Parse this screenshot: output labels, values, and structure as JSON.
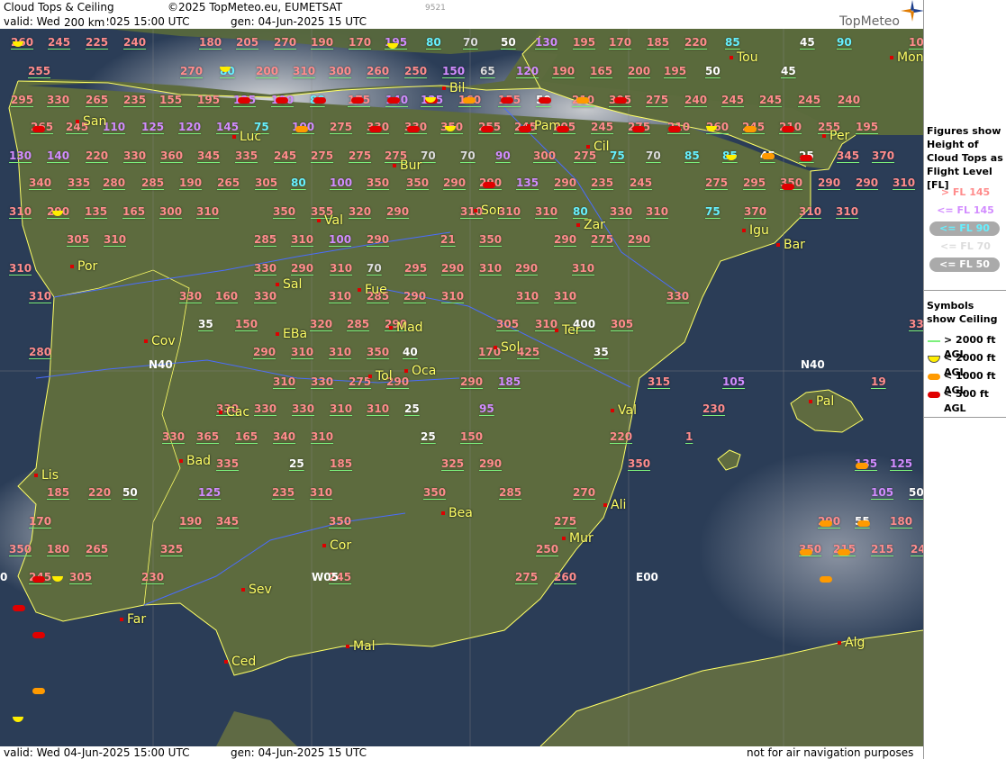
{
  "header": {
    "title": "Cloud Tops & Ceiling",
    "copyright": "©2025 TopMeteo.eu, EUMETSAT",
    "valid": "valid:  Wed  04-Jun-2025  15:00 UTC",
    "gen": "gen: 04-Jun-2025 15 UTC",
    "code": "9521",
    "brand": "TopMeteo"
  },
  "footer": {
    "valid": "valid:  Wed  04-Jun-2025  15:00 UTC",
    "gen": "gen: 04-Jun-2025 15 UTC",
    "disclaimer": "not for air navigation purposes"
  },
  "scale": {
    "label": "200 km"
  },
  "colors": {
    "above145": "#ff8c8c",
    "le145": "#d28cff",
    "le90": "#66f0ff",
    "le70": "#dcdcdc",
    "le50": "#ffffff",
    "sea": "#2b3d57",
    "land": "#5b6b3c",
    "coast": "#ffff66",
    "rivers": "#4a6cff"
  },
  "legend": {
    "figures_title": "Figures show Height of Cloud Tops as Flight Level  [FL]",
    "fl_items": [
      {
        "label": "> FL 145",
        "color": "#ff8c8c",
        "pill": false
      },
      {
        "label": "<= FL 145",
        "color": "#d28cff",
        "pill": false
      },
      {
        "label": "<= FL 90",
        "color": "#66f0ff",
        "pill": true
      },
      {
        "label": "<= FL 70",
        "color": "#dcdcdc",
        "pill": false
      },
      {
        "label": "<= FL 50",
        "color": "#ffffff",
        "pill": true
      }
    ],
    "symbols_title": "Symbols show Ceiling",
    "ceiling_items": [
      {
        "label": "> 2000 ft AGL",
        "symbol": "green-line"
      },
      {
        "label": "< 2000 ft AGL",
        "symbol": "yellow-half"
      },
      {
        "label": "< 1000 ft AGL",
        "symbol": "orange-pill"
      },
      {
        "label": "< 500 ft AGL",
        "symbol": "red-pill"
      }
    ]
  },
  "grid_labels": [
    "N40",
    "N40",
    "W05",
    "E00",
    "0"
  ],
  "cities": [
    "Tou",
    "Mon",
    "Bil",
    "San",
    "Pam",
    "Luc",
    "Cil",
    "Per",
    "Bur",
    "Val",
    "Sor",
    "Zar",
    "Igu",
    "Bar",
    "Por",
    "Sal",
    "Fue",
    "Mad",
    "Ter",
    "Cov",
    "EBa",
    "Oca",
    "Tol",
    "Sol",
    "Pal",
    "Cac",
    "Val",
    "Bad",
    "Lis",
    "Bea",
    "Ali",
    "Mur",
    "Cor",
    "Sev",
    "Far",
    "Mal",
    "Ced",
    "Alg"
  ],
  "flight_levels": [
    {
      "v": "260",
      "c": "above145"
    },
    {
      "v": "245",
      "c": "above145"
    },
    {
      "v": "225",
      "c": "above145"
    },
    {
      "v": "240",
      "c": "above145"
    },
    {
      "v": "180",
      "c": "above145"
    },
    {
      "v": "205",
      "c": "above145"
    },
    {
      "v": "270",
      "c": "above145"
    },
    {
      "v": "190",
      "c": "above145"
    },
    {
      "v": "170",
      "c": "above145"
    },
    {
      "v": "195",
      "c": "le145"
    },
    {
      "v": "80",
      "c": "le90"
    },
    {
      "v": "70",
      "c": "le70"
    },
    {
      "v": "50",
      "c": "le50"
    },
    {
      "v": "130",
      "c": "le145"
    },
    {
      "v": "195",
      "c": "above145"
    },
    {
      "v": "170",
      "c": "above145"
    },
    {
      "v": "185",
      "c": "above145"
    },
    {
      "v": "220",
      "c": "above145"
    },
    {
      "v": "85",
      "c": "le90"
    },
    {
      "v": "45",
      "c": "le50"
    },
    {
      "v": "90",
      "c": "le90"
    },
    {
      "v": "10",
      "c": "above145"
    },
    {
      "v": "255",
      "c": "above145"
    },
    {
      "v": "270",
      "c": "above145"
    },
    {
      "v": "80",
      "c": "le90"
    },
    {
      "v": "200",
      "c": "above145"
    },
    {
      "v": "310",
      "c": "above145"
    },
    {
      "v": "300",
      "c": "above145"
    },
    {
      "v": "260",
      "c": "above145"
    },
    {
      "v": "250",
      "c": "above145"
    },
    {
      "v": "150",
      "c": "le145"
    },
    {
      "v": "65",
      "c": "le70"
    },
    {
      "v": "120",
      "c": "le145"
    },
    {
      "v": "190",
      "c": "above145"
    },
    {
      "v": "165",
      "c": "above145"
    },
    {
      "v": "200",
      "c": "above145"
    },
    {
      "v": "195",
      "c": "above145"
    },
    {
      "v": "50",
      "c": "le50"
    },
    {
      "v": "45",
      "c": "le50"
    },
    {
      "v": "295",
      "c": "above145"
    },
    {
      "v": "330",
      "c": "above145"
    },
    {
      "v": "265",
      "c": "above145"
    },
    {
      "v": "235",
      "c": "above145"
    },
    {
      "v": "155",
      "c": "above145"
    },
    {
      "v": "195",
      "c": "above145"
    },
    {
      "v": "125",
      "c": "le145"
    },
    {
      "v": "100",
      "c": "le145"
    },
    {
      "v": "80",
      "c": "le90"
    },
    {
      "v": "175",
      "c": "above145"
    },
    {
      "v": "140",
      "c": "le145"
    },
    {
      "v": "125",
      "c": "le145"
    },
    {
      "v": "160",
      "c": "above145"
    },
    {
      "v": "155",
      "c": "above145"
    },
    {
      "v": "50",
      "c": "le50"
    },
    {
      "v": "210",
      "c": "above145"
    },
    {
      "v": "305",
      "c": "above145"
    },
    {
      "v": "275",
      "c": "above145"
    },
    {
      "v": "240",
      "c": "above145"
    },
    {
      "v": "245",
      "c": "above145"
    },
    {
      "v": "245",
      "c": "above145"
    },
    {
      "v": "245",
      "c": "above145"
    },
    {
      "v": "240",
      "c": "above145"
    },
    {
      "v": "265",
      "c": "above145"
    },
    {
      "v": "245",
      "c": "above145"
    },
    {
      "v": "110",
      "c": "le145"
    },
    {
      "v": "125",
      "c": "le145"
    },
    {
      "v": "120",
      "c": "le145"
    },
    {
      "v": "145",
      "c": "le145"
    },
    {
      "v": "75",
      "c": "le90"
    },
    {
      "v": "100",
      "c": "le145"
    },
    {
      "v": "275",
      "c": "above145"
    },
    {
      "v": "330",
      "c": "above145"
    },
    {
      "v": "330",
      "c": "above145"
    },
    {
      "v": "350",
      "c": "above145"
    },
    {
      "v": "255",
      "c": "above145"
    },
    {
      "v": "245",
      "c": "above145"
    },
    {
      "v": "205",
      "c": "above145"
    },
    {
      "v": "245",
      "c": "above145"
    },
    {
      "v": "275",
      "c": "above145"
    },
    {
      "v": "210",
      "c": "above145"
    },
    {
      "v": "260",
      "c": "above145"
    },
    {
      "v": "245",
      "c": "above145"
    },
    {
      "v": "210",
      "c": "above145"
    },
    {
      "v": "255",
      "c": "above145"
    },
    {
      "v": "195",
      "c": "above145"
    },
    {
      "v": "130",
      "c": "le145"
    },
    {
      "v": "140",
      "c": "le145"
    },
    {
      "v": "220",
      "c": "above145"
    },
    {
      "v": "330",
      "c": "above145"
    },
    {
      "v": "360",
      "c": "above145"
    },
    {
      "v": "345",
      "c": "above145"
    },
    {
      "v": "335",
      "c": "above145"
    },
    {
      "v": "245",
      "c": "above145"
    },
    {
      "v": "275",
      "c": "above145"
    },
    {
      "v": "275",
      "c": "above145"
    },
    {
      "v": "275",
      "c": "above145"
    },
    {
      "v": "70",
      "c": "le70"
    },
    {
      "v": "70",
      "c": "le70"
    },
    {
      "v": "90",
      "c": "le145"
    },
    {
      "v": "300",
      "c": "above145"
    },
    {
      "v": "275",
      "c": "above145"
    },
    {
      "v": "75",
      "c": "le90"
    },
    {
      "v": "70",
      "c": "le70"
    },
    {
      "v": "85",
      "c": "le90"
    },
    {
      "v": "85",
      "c": "le90"
    },
    {
      "v": "45",
      "c": "le50"
    },
    {
      "v": "25",
      "c": "le50"
    },
    {
      "v": "345",
      "c": "above145"
    },
    {
      "v": "370",
      "c": "above145"
    },
    {
      "v": "340",
      "c": "above145"
    },
    {
      "v": "335",
      "c": "above145"
    },
    {
      "v": "280",
      "c": "above145"
    },
    {
      "v": "285",
      "c": "above145"
    },
    {
      "v": "190",
      "c": "above145"
    },
    {
      "v": "265",
      "c": "above145"
    },
    {
      "v": "305",
      "c": "above145"
    },
    {
      "v": "80",
      "c": "le90"
    },
    {
      "v": "100",
      "c": "le145"
    },
    {
      "v": "350",
      "c": "above145"
    },
    {
      "v": "350",
      "c": "above145"
    },
    {
      "v": "290",
      "c": "above145"
    },
    {
      "v": "290",
      "c": "above145"
    },
    {
      "v": "135",
      "c": "le145"
    },
    {
      "v": "290",
      "c": "above145"
    },
    {
      "v": "235",
      "c": "above145"
    },
    {
      "v": "245",
      "c": "above145"
    },
    {
      "v": "275",
      "c": "above145"
    },
    {
      "v": "295",
      "c": "above145"
    },
    {
      "v": "350",
      "c": "above145"
    },
    {
      "v": "290",
      "c": "above145"
    },
    {
      "v": "290",
      "c": "above145"
    },
    {
      "v": "310",
      "c": "above145"
    },
    {
      "v": "310",
      "c": "above145"
    },
    {
      "v": "290",
      "c": "above145"
    },
    {
      "v": "135",
      "c": "above145"
    },
    {
      "v": "165",
      "c": "above145"
    },
    {
      "v": "300",
      "c": "above145"
    },
    {
      "v": "310",
      "c": "above145"
    },
    {
      "v": "350",
      "c": "above145"
    },
    {
      "v": "355",
      "c": "above145"
    },
    {
      "v": "320",
      "c": "above145"
    },
    {
      "v": "290",
      "c": "above145"
    },
    {
      "v": "310",
      "c": "above145"
    },
    {
      "v": "310",
      "c": "above145"
    },
    {
      "v": "310",
      "c": "above145"
    },
    {
      "v": "80",
      "c": "le90"
    },
    {
      "v": "330",
      "c": "above145"
    },
    {
      "v": "310",
      "c": "above145"
    },
    {
      "v": "75",
      "c": "le90"
    },
    {
      "v": "370",
      "c": "above145"
    },
    {
      "v": "310",
      "c": "above145"
    },
    {
      "v": "310",
      "c": "above145"
    },
    {
      "v": "305",
      "c": "above145"
    },
    {
      "v": "310",
      "c": "above145"
    },
    {
      "v": "285",
      "c": "above145"
    },
    {
      "v": "310",
      "c": "above145"
    },
    {
      "v": "100",
      "c": "le145"
    },
    {
      "v": "290",
      "c": "above145"
    },
    {
      "v": "21",
      "c": "above145"
    },
    {
      "v": "350",
      "c": "above145"
    },
    {
      "v": "290",
      "c": "above145"
    },
    {
      "v": "275",
      "c": "above145"
    },
    {
      "v": "290",
      "c": "above145"
    },
    {
      "v": "310",
      "c": "above145"
    },
    {
      "v": "330",
      "c": "above145"
    },
    {
      "v": "290",
      "c": "above145"
    },
    {
      "v": "310",
      "c": "above145"
    },
    {
      "v": "70",
      "c": "le70"
    },
    {
      "v": "295",
      "c": "above145"
    },
    {
      "v": "290",
      "c": "above145"
    },
    {
      "v": "310",
      "c": "above145"
    },
    {
      "v": "290",
      "c": "above145"
    },
    {
      "v": "310",
      "c": "above145"
    },
    {
      "v": "310",
      "c": "above145"
    },
    {
      "v": "330",
      "c": "above145"
    },
    {
      "v": "160",
      "c": "above145"
    },
    {
      "v": "330",
      "c": "above145"
    },
    {
      "v": "310",
      "c": "above145"
    },
    {
      "v": "285",
      "c": "above145"
    },
    {
      "v": "290",
      "c": "above145"
    },
    {
      "v": "310",
      "c": "above145"
    },
    {
      "v": "310",
      "c": "above145"
    },
    {
      "v": "310",
      "c": "above145"
    },
    {
      "v": "330",
      "c": "above145"
    },
    {
      "v": "35",
      "c": "le50"
    },
    {
      "v": "150",
      "c": "above145"
    },
    {
      "v": "320",
      "c": "above145"
    },
    {
      "v": "285",
      "c": "above145"
    },
    {
      "v": "290",
      "c": "above145"
    },
    {
      "v": "305",
      "c": "above145"
    },
    {
      "v": "310",
      "c": "above145"
    },
    {
      "v": "400",
      "c": "le50"
    },
    {
      "v": "305",
      "c": "above145"
    },
    {
      "v": "330",
      "c": "above145"
    },
    {
      "v": "280",
      "c": "above145"
    },
    {
      "v": "290",
      "c": "above145"
    },
    {
      "v": "310",
      "c": "above145"
    },
    {
      "v": "310",
      "c": "above145"
    },
    {
      "v": "350",
      "c": "above145"
    },
    {
      "v": "40",
      "c": "le50"
    },
    {
      "v": "170",
      "c": "above145"
    },
    {
      "v": "425",
      "c": "above145"
    },
    {
      "v": "35",
      "c": "le50"
    },
    {
      "v": "310",
      "c": "above145"
    },
    {
      "v": "330",
      "c": "above145"
    },
    {
      "v": "275",
      "c": "above145"
    },
    {
      "v": "290",
      "c": "above145"
    },
    {
      "v": "290",
      "c": "above145"
    },
    {
      "v": "185",
      "c": "le145"
    },
    {
      "v": "315",
      "c": "above145"
    },
    {
      "v": "105",
      "c": "le145"
    },
    {
      "v": "19",
      "c": "above145"
    },
    {
      "v": "330",
      "c": "above145"
    },
    {
      "v": "330",
      "c": "above145"
    },
    {
      "v": "330",
      "c": "above145"
    },
    {
      "v": "310",
      "c": "above145"
    },
    {
      "v": "310",
      "c": "above145"
    },
    {
      "v": "25",
      "c": "le50"
    },
    {
      "v": "95",
      "c": "le145"
    },
    {
      "v": "230",
      "c": "above145"
    },
    {
      "v": "330",
      "c": "above145"
    },
    {
      "v": "365",
      "c": "above145"
    },
    {
      "v": "165",
      "c": "above145"
    },
    {
      "v": "340",
      "c": "above145"
    },
    {
      "v": "310",
      "c": "above145"
    },
    {
      "v": "25",
      "c": "le50"
    },
    {
      "v": "150",
      "c": "above145"
    },
    {
      "v": "220",
      "c": "above145"
    },
    {
      "v": "1",
      "c": "above145"
    },
    {
      "v": "335",
      "c": "above145"
    },
    {
      "v": "25",
      "c": "le50"
    },
    {
      "v": "185",
      "c": "above145"
    },
    {
      "v": "325",
      "c": "above145"
    },
    {
      "v": "290",
      "c": "above145"
    },
    {
      "v": "350",
      "c": "above145"
    },
    {
      "v": "135",
      "c": "le145"
    },
    {
      "v": "125",
      "c": "le145"
    },
    {
      "v": "185",
      "c": "above145"
    },
    {
      "v": "220",
      "c": "above145"
    },
    {
      "v": "50",
      "c": "le50"
    },
    {
      "v": "125",
      "c": "le145"
    },
    {
      "v": "235",
      "c": "above145"
    },
    {
      "v": "310",
      "c": "above145"
    },
    {
      "v": "350",
      "c": "above145"
    },
    {
      "v": "285",
      "c": "above145"
    },
    {
      "v": "270",
      "c": "above145"
    },
    {
      "v": "105",
      "c": "le145"
    },
    {
      "v": "50",
      "c": "le50"
    },
    {
      "v": "170",
      "c": "above145"
    },
    {
      "v": "190",
      "c": "above145"
    },
    {
      "v": "345",
      "c": "above145"
    },
    {
      "v": "350",
      "c": "above145"
    },
    {
      "v": "275",
      "c": "above145"
    },
    {
      "v": "290",
      "c": "above145"
    },
    {
      "v": "55",
      "c": "le50"
    },
    {
      "v": "180",
      "c": "above145"
    },
    {
      "v": "350",
      "c": "above145"
    },
    {
      "v": "180",
      "c": "above145"
    },
    {
      "v": "265",
      "c": "above145"
    },
    {
      "v": "325",
      "c": "above145"
    },
    {
      "v": "250",
      "c": "above145"
    },
    {
      "v": "350",
      "c": "above145"
    },
    {
      "v": "215",
      "c": "above145"
    },
    {
      "v": "215",
      "c": "above145"
    },
    {
      "v": "240",
      "c": "above145"
    },
    {
      "v": "245",
      "c": "above145"
    },
    {
      "v": "305",
      "c": "above145"
    },
    {
      "v": "230",
      "c": "above145"
    },
    {
      "v": "245",
      "c": "above145"
    },
    {
      "v": "275",
      "c": "above145"
    },
    {
      "v": "260",
      "c": "above145"
    }
  ]
}
